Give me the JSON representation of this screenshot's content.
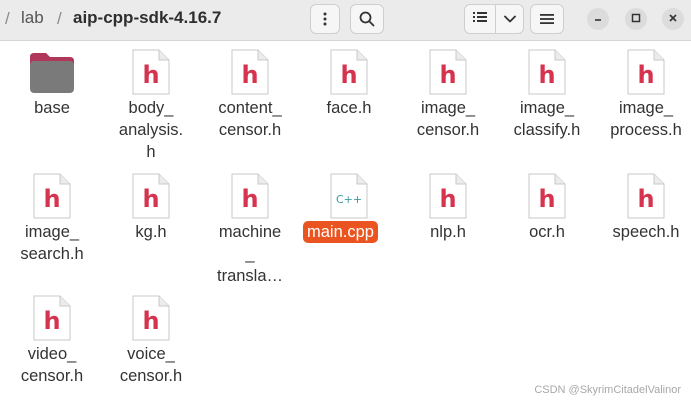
{
  "breadcrumb": {
    "parent": "lab",
    "current": "aip-cpp-sdk-4.16.7",
    "separator": "/"
  },
  "toolbar": {
    "menu_icon": "vertical-ellipsis-icon",
    "search_icon": "search-icon",
    "list_view_icon": "list-view-icon",
    "view_options_icon": "chevron-down-icon",
    "main_menu_icon": "hamburger-menu-icon",
    "minimize_icon": "minimize-icon",
    "maximize_icon": "maximize-icon",
    "close_icon": "close-icon"
  },
  "files": [
    {
      "name": "base",
      "type": "folder"
    },
    {
      "name": "body_\nanalysis.\nh",
      "type": "h"
    },
    {
      "name": "content_\ncensor.h",
      "type": "h"
    },
    {
      "name": "face.h",
      "type": "h"
    },
    {
      "name": "image_\ncensor.h",
      "type": "h"
    },
    {
      "name": "image_\nclassify.h",
      "type": "h"
    },
    {
      "name": "image_\nprocess.h",
      "type": "h"
    },
    {
      "name": "image_\nsearch.h",
      "type": "h"
    },
    {
      "name": "kg.h",
      "type": "h"
    },
    {
      "name": "machine\n_\ntransla…",
      "type": "h"
    },
    {
      "name": "main.cpp",
      "type": "cpp",
      "selected": true
    },
    {
      "name": "nlp.h",
      "type": "h"
    },
    {
      "name": "ocr.h",
      "type": "h"
    },
    {
      "name": "speech.h",
      "type": "h"
    },
    {
      "name": "video_\ncensor.h",
      "type": "h"
    },
    {
      "name": "voice_\ncensor.h",
      "type": "h"
    }
  ],
  "file_icon_labels": {
    "h": "h",
    "cpp": "C++"
  },
  "colors": {
    "header_glyph": "#d6334f",
    "cpp_glyph": "#3a9aa0",
    "selection": "#e95420",
    "folder": "#7a7a7a",
    "folder_tab": "#b0375a"
  },
  "watermark": "CSDN @SkyrimCitadelValinor"
}
